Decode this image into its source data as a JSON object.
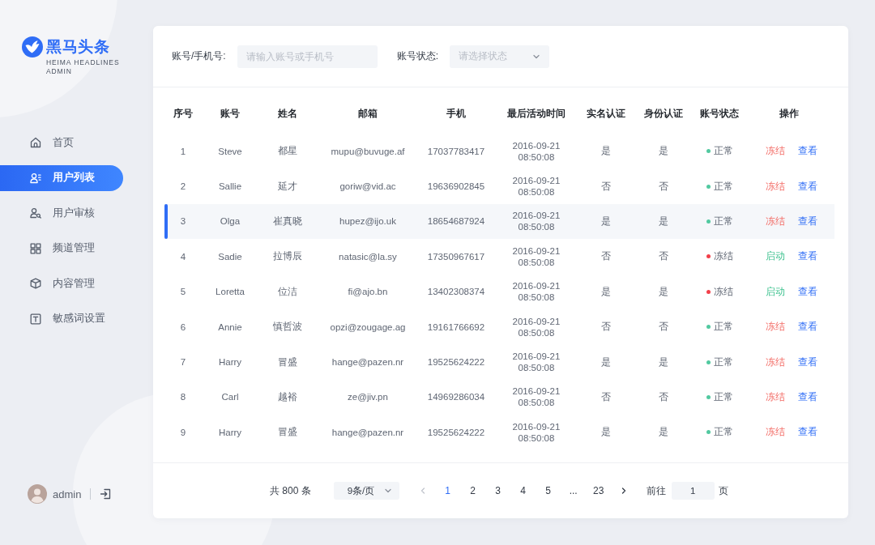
{
  "sidebar": {
    "logo": {
      "title": "黑马头条",
      "subtitle": "HEIMA HEADLINES ADMIN"
    },
    "menu": [
      {
        "label": "首页",
        "selected": false
      },
      {
        "label": "用户列表",
        "selected": true
      },
      {
        "label": "用户审核",
        "selected": false
      },
      {
        "label": "频道管理",
        "selected": false
      },
      {
        "label": "内容管理",
        "selected": false
      },
      {
        "label": "敏感词设置",
        "selected": false
      }
    ],
    "user": {
      "name": "admin"
    }
  },
  "filters": {
    "account": {
      "label": "账号/手机号:",
      "placeholder": "请输入账号或手机号"
    },
    "status": {
      "label": "账号状态:",
      "placeholder": "请选择状态"
    }
  },
  "table": {
    "columns": [
      "序号",
      "账号",
      "姓名",
      "邮箱",
      "手机",
      "最后活动时间",
      "实名认证",
      "身份认证",
      "账号状态",
      "操作"
    ],
    "rows": [
      {
        "index": "1",
        "account": "Steve",
        "name": "都星",
        "email": "mupu@buvuge.af",
        "phone": "17037783417",
        "last_active": "2016-09-21 08:50:08",
        "real_name": "是",
        "identity": "是",
        "status": {
          "label": "正常",
          "color": "#52c9a0"
        },
        "actions": [
          {
            "label": "冻结",
            "kind": "danger"
          },
          {
            "label": "查看",
            "kind": "link"
          }
        ],
        "selected": false
      },
      {
        "index": "2",
        "account": "Sallie",
        "name": "延才",
        "email": "goriw@vid.ac",
        "phone": "19636902845",
        "last_active": "2016-09-21 08:50:08",
        "real_name": "否",
        "identity": "否",
        "status": {
          "label": "正常",
          "color": "#52c9a0"
        },
        "actions": [
          {
            "label": "冻结",
            "kind": "danger"
          },
          {
            "label": "查看",
            "kind": "link"
          }
        ],
        "selected": false
      },
      {
        "index": "3",
        "account": "Olga",
        "name": "崔真晓",
        "email": "hupez@ijo.uk",
        "phone": "18654687924",
        "last_active": "2016-09-21 08:50:08",
        "real_name": "是",
        "identity": "是",
        "status": {
          "label": "正常",
          "color": "#52c9a0"
        },
        "actions": [
          {
            "label": "冻结",
            "kind": "danger"
          },
          {
            "label": "查看",
            "kind": "link"
          }
        ],
        "selected": true
      },
      {
        "index": "4",
        "account": "Sadie",
        "name": "拉博辰",
        "email": "natasic@la.sy",
        "phone": "17350967617",
        "last_active": "2016-09-21 08:50:08",
        "real_name": "否",
        "identity": "否",
        "status": {
          "label": "冻结",
          "color": "#f2404a"
        },
        "actions": [
          {
            "label": "启动",
            "kind": "success"
          },
          {
            "label": "查看",
            "kind": "link"
          }
        ],
        "selected": false
      },
      {
        "index": "5",
        "account": "Loretta",
        "name": "位洁",
        "email": "fi@ajo.bn",
        "phone": "13402308374",
        "last_active": "2016-09-21 08:50:08",
        "real_name": "是",
        "identity": "是",
        "status": {
          "label": "冻结",
          "color": "#f2404a"
        },
        "actions": [
          {
            "label": "启动",
            "kind": "success"
          },
          {
            "label": "查看",
            "kind": "link"
          }
        ],
        "selected": false
      },
      {
        "index": "6",
        "account": "Annie",
        "name": "慎哲波",
        "email": "opzi@zougage.ag",
        "phone": "19161766692",
        "last_active": "2016-09-21 08:50:08",
        "real_name": "否",
        "identity": "否",
        "status": {
          "label": "正常",
          "color": "#52c9a0"
        },
        "actions": [
          {
            "label": "冻结",
            "kind": "danger"
          },
          {
            "label": "查看",
            "kind": "link"
          }
        ],
        "selected": false
      },
      {
        "index": "7",
        "account": "Harry",
        "name": "冒盛",
        "email": "hange@pazen.nr",
        "phone": "19525624222",
        "last_active": "2016-09-21 08:50:08",
        "real_name": "是",
        "identity": "是",
        "status": {
          "label": "正常",
          "color": "#52c9a0"
        },
        "actions": [
          {
            "label": "冻结",
            "kind": "danger"
          },
          {
            "label": "查看",
            "kind": "link"
          }
        ],
        "selected": false
      },
      {
        "index": "8",
        "account": "Carl",
        "name": "越裕",
        "email": "ze@jiv.pn",
        "phone": "14969286034",
        "last_active": "2016-09-21 08:50:08",
        "real_name": "否",
        "identity": "否",
        "status": {
          "label": "正常",
          "color": "#52c9a0"
        },
        "actions": [
          {
            "label": "冻结",
            "kind": "danger"
          },
          {
            "label": "查看",
            "kind": "link"
          }
        ],
        "selected": false
      },
      {
        "index": "9",
        "account": "Harry",
        "name": "冒盛",
        "email": "hange@pazen.nr",
        "phone": "19525624222",
        "last_active": "2016-09-21 08:50:08",
        "real_name": "是",
        "identity": "是",
        "status": {
          "label": "正常",
          "color": "#52c9a0"
        },
        "actions": [
          {
            "label": "冻结",
            "kind": "danger"
          },
          {
            "label": "查看",
            "kind": "link"
          }
        ],
        "selected": false
      }
    ]
  },
  "pagination": {
    "total": "共 800 条",
    "page_size": "9条/页",
    "prev": {
      "disabled": true
    },
    "pages": [
      {
        "label": "1",
        "selected": true
      },
      {
        "label": "2",
        "selected": false
      },
      {
        "label": "3",
        "selected": false
      },
      {
        "label": "4",
        "selected": false
      },
      {
        "label": "5",
        "selected": false
      },
      {
        "label": "...",
        "selected": false
      },
      {
        "label": "23",
        "selected": false
      }
    ],
    "next": {
      "disabled": false
    },
    "goto_label": "前往",
    "goto_value": "1",
    "goto_suffix": "页"
  }
}
